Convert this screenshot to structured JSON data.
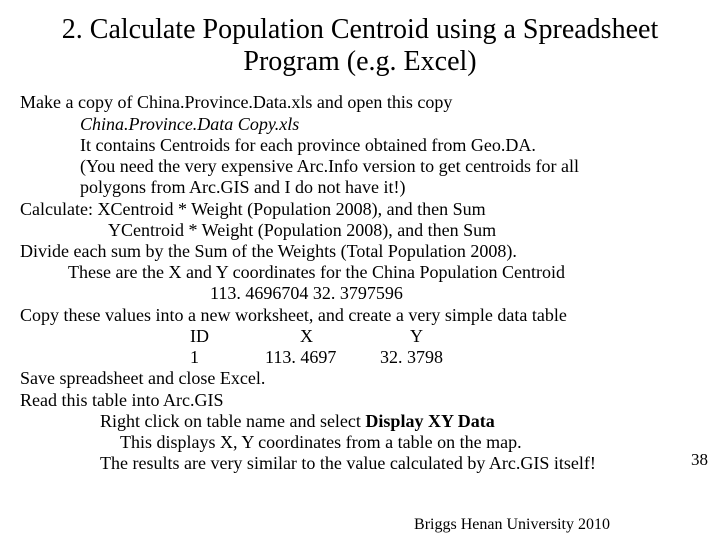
{
  "title": "2. Calculate Population Centroid using a Spreadsheet Program (e.g. Excel)",
  "lines": {
    "l01": "Make a copy of China.Province.Data.xls and open this copy",
    "l02": "China.Province.Data Copy.xls",
    "l03": "It contains Centroids  for each province obtained from Geo.DA.",
    "l04": "(You need the very expensive Arc.Info version to get centroids for all",
    "l05": "polygons  from Arc.GIS and I do not have it!)",
    "l06": "Calculate:  XCentroid * Weight (Population 2008),  and then Sum",
    "l07": "YCentroid * Weight (Population 2008),  and then Sum",
    "l08": " Divide each sum by the Sum of the Weights (Total Population 2008).",
    "l09": "These are the X and Y coordinates for the China Population Centroid",
    "l10": "113. 4696704    32. 3797596",
    "l11": "Copy these values into a new worksheet, and create a very simple data table",
    "l12a": "ID",
    "l12b": "X",
    "l12c": "Y",
    "l13a": "1",
    "l13b": "113. 4697",
    "l13c": "32. 3798",
    "l14": "Save spreadsheet and close Excel.",
    "l15": "Read this table into Arc.GIS",
    "l16a": "Right click on table name and select ",
    "l16b": "Display XY Data",
    "l17": "This displays X, Y coordinates from a table on the map.",
    "l18": "The results are very similar to the value calculated by Arc.GIS itself!"
  },
  "footer": "Briggs  Henan University 2010",
  "pagenum": "38",
  "chart_data": {
    "type": "table",
    "title": "Population Centroid Coordinates",
    "columns": [
      "ID",
      "X",
      "Y"
    ],
    "rows": [
      [
        1,
        113.4697,
        32.3798
      ]
    ],
    "full_precision": {
      "X": 113.4696704,
      "Y": 32.3797596
    }
  }
}
